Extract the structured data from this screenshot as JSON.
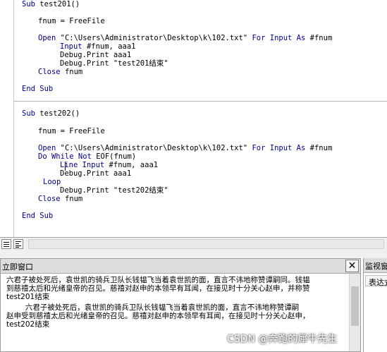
{
  "code": {
    "sub1": {
      "decl_kw": "Sub",
      "decl_name": "test201()",
      "fnum": "fnum = FreeFile",
      "open_kw": "Open",
      "open_path": "\"C:\\Users\\Administrator\\Desktop\\k\\102.txt\"",
      "open_for": "For Input As",
      "open_var": "#fnum",
      "input_kw": "Input",
      "input_args": "#fnum, aaa1",
      "debug1": "Debug.Print aaa1",
      "debug2": "Debug.Print \"test201结束\"",
      "close_kw": "Close",
      "close_arg": "fnum",
      "end": "End Sub"
    },
    "sub2": {
      "decl_kw": "Sub",
      "decl_name": "test202()",
      "fnum": "fnum = FreeFile",
      "open_kw": "Open",
      "open_path": "\"C:\\Users\\Administrator\\Desktop\\k\\102.txt\"",
      "open_for": "For Input As",
      "open_var": "#fnum",
      "do_while": "Do While Not",
      "do_eof": "EOF(fnum)",
      "line_input": "Line Input",
      "line_input_args": "#fnum, aaa1",
      "debug1": "Debug.Print aaa1",
      "loop": "Loop",
      "debug2": "Debug.Print \"test202结束\"",
      "close_kw": "Close",
      "close_arg": "fnum",
      "end": "End Sub"
    }
  },
  "view_bar": {
    "procedure_view_icon": "procedure-view-icon",
    "full_module_view_icon": "full-module-view-icon"
  },
  "immediate": {
    "title": "立即窗口",
    "close_label": "✕",
    "lines": [
      "六君子被处死后，袁世凯的骑兵卫队长钱韫飞当着袁世凯的面，直言不讳地称赞谭嗣同。钱韫",
      "到慈禧太后和光绪皇帝的召见。慈禧对赵申的本领早有耳闻，在接见时十分关心赵申，并称赞",
      "test201结束",
      "        六君子被处死后，袁世凯的骑兵卫队长钱韫飞当着袁世凯的面，直言不讳地称赞谭嗣",
      "赵申受到慈禧太后和光绪皇帝的召见。慈禧对赵申的本领早有耳闻，在接见时十分关心赵申，",
      "test202结束"
    ]
  },
  "watch": {
    "title": "监视窗口",
    "column": "表达式"
  },
  "watermark": "CSDN @奔跑的犀牛先生",
  "colors": {
    "keyword": "#00008b",
    "pane_title_bg": "#dcdcdc",
    "toolbar_bg": "#f0f0f0"
  }
}
